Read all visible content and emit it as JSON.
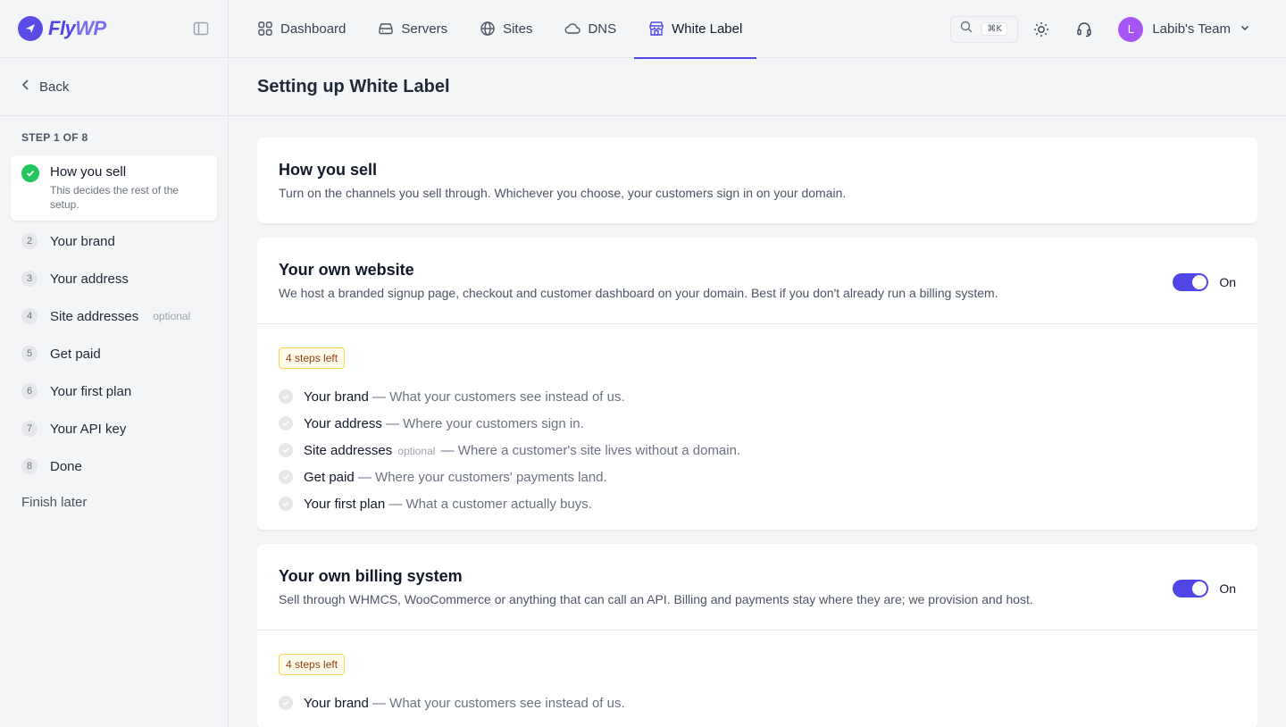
{
  "brand": {
    "name_a": "Fly",
    "name_b": "WP"
  },
  "nav": {
    "items": [
      {
        "label": "Dashboard",
        "icon": "grid-icon"
      },
      {
        "label": "Servers",
        "icon": "server-icon"
      },
      {
        "label": "Sites",
        "icon": "globe-icon"
      },
      {
        "label": "DNS",
        "icon": "cloud-icon"
      },
      {
        "label": "White Label",
        "icon": "storefront-icon",
        "active": true
      }
    ],
    "search_shortcut": "⌘K",
    "team_initial": "L",
    "team_name": "Labib's Team"
  },
  "sidebar": {
    "back_label": "Back",
    "step_counter": "STEP 1 OF 8",
    "active_step": {
      "title": "How you sell",
      "desc": "This decides the rest of the setup."
    },
    "steps": [
      {
        "num": "2",
        "label": "Your brand",
        "optional": ""
      },
      {
        "num": "3",
        "label": "Your address",
        "optional": ""
      },
      {
        "num": "4",
        "label": "Site addresses",
        "optional": "optional"
      },
      {
        "num": "5",
        "label": "Get paid",
        "optional": ""
      },
      {
        "num": "6",
        "label": "Your first plan",
        "optional": ""
      },
      {
        "num": "7",
        "label": "Your API key",
        "optional": ""
      },
      {
        "num": "8",
        "label": "Done",
        "optional": ""
      }
    ],
    "finish_later": "Finish later"
  },
  "page": {
    "title": "Setting up White Label"
  },
  "intro": {
    "title": "How you sell",
    "desc": "Turn on the channels you sell through. Whichever you choose, your customers sign in on your domain."
  },
  "website": {
    "title": "Your own website",
    "desc": "We host a branded signup page, checkout and customer dashboard on your domain. Best if you don't already run a billing system.",
    "toggle_label": "On",
    "enabled": true,
    "badge": "4 steps left",
    "checklist": [
      {
        "name": "Your brand",
        "optional": "",
        "rest": "— What your customers see instead of us."
      },
      {
        "name": "Your address",
        "optional": "",
        "rest": "— Where your customers sign in."
      },
      {
        "name": "Site addresses",
        "optional": "optional",
        "rest": "— Where a customer's site lives without a domain."
      },
      {
        "name": "Get paid",
        "optional": "",
        "rest": "— Where your customers' payments land."
      },
      {
        "name": "Your first plan",
        "optional": "",
        "rest": "— What a customer actually buys."
      }
    ]
  },
  "billing": {
    "title": "Your own billing system",
    "desc": "Sell through WHMCS, WooCommerce or anything that can call an API. Billing and payments stay where they are; we provision and host.",
    "toggle_label": "On",
    "enabled": true,
    "badge": "4 steps left",
    "checklist": [
      {
        "name": "Your brand",
        "optional": "",
        "rest": "— What your customers see instead of us."
      }
    ]
  },
  "colors": {
    "accent": "#4f46e5",
    "success": "#22c55e",
    "avatar": "#a855f7"
  }
}
